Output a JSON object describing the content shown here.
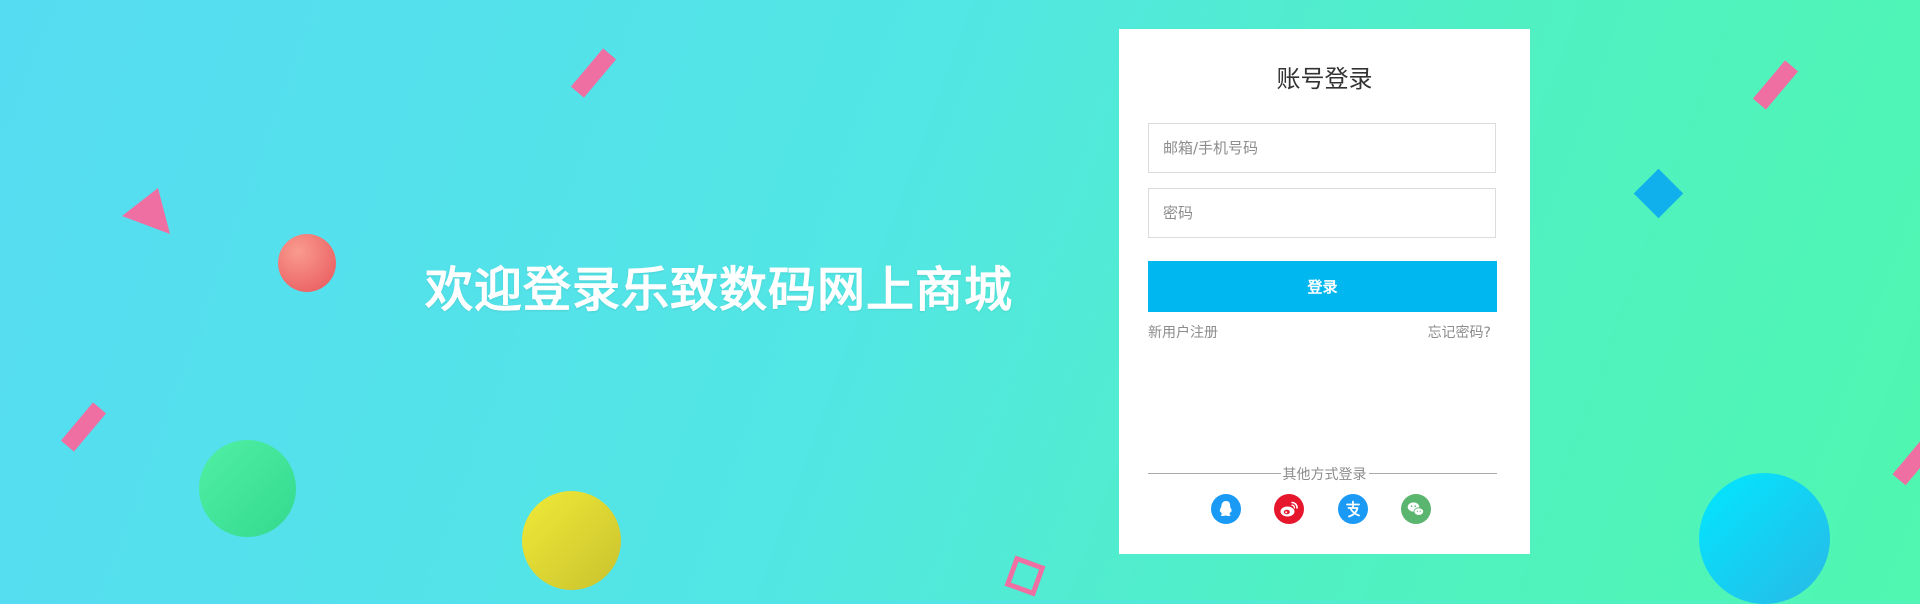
{
  "welcome": {
    "text": "欢迎登录乐致数码网上商城"
  },
  "login": {
    "title": "账号登录",
    "account_placeholder": "邮箱/手机号码",
    "password_placeholder": "密码",
    "submit_label": "登录",
    "register_link": "新用户注册",
    "forgot_link": "忘记密码?",
    "other_methods_label": "其他方式登录",
    "social": [
      {
        "name": "qq",
        "icon": "qq-icon",
        "color": "#1a9af5"
      },
      {
        "name": "weibo",
        "icon": "weibo-icon",
        "color": "#e6162d"
      },
      {
        "name": "alipay",
        "icon": "alipay-icon",
        "color": "#1a9af5"
      },
      {
        "name": "wechat",
        "icon": "wechat-icon",
        "color": "#5ab56e"
      }
    ]
  },
  "colors": {
    "primary_button": "#00b7f0",
    "decor_pink": "#ef6fa3",
    "background_start": "#56dcf2",
    "background_end": "#4ff7b0"
  }
}
